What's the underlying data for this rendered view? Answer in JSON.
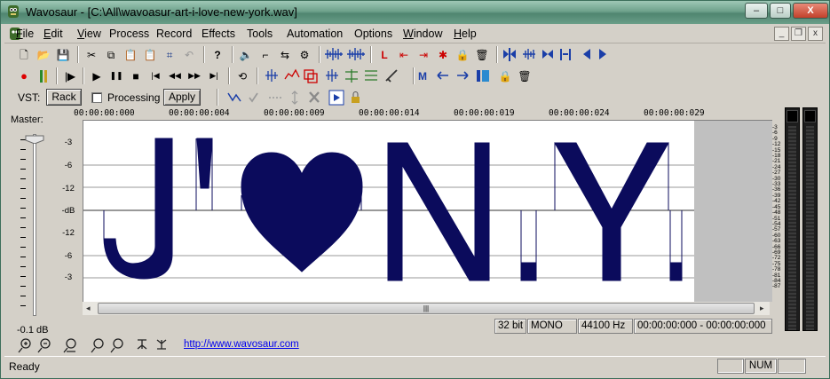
{
  "window": {
    "title": "Wavosaur - [C:\\All\\wavoasur-art-i-love-new-york.wav]",
    "buttons": {
      "minimize": "–",
      "maximize": "□",
      "close": "X"
    },
    "mdi_buttons": {
      "minimize": "_",
      "restore": "❐",
      "close": "x"
    }
  },
  "menu": [
    {
      "label": "File",
      "u": "F",
      "rest": "ile"
    },
    {
      "label": "Edit",
      "u": "E",
      "rest": "dit"
    },
    {
      "label": "View",
      "u": "V",
      "rest": "iew"
    },
    {
      "label": "Process",
      "u": "",
      "rest": "Process"
    },
    {
      "label": "Record",
      "u": "",
      "rest": "Record"
    },
    {
      "label": "Effects",
      "u": "",
      "rest": "Effects"
    },
    {
      "label": "Tools",
      "u": "",
      "rest": "Tools"
    },
    {
      "label": "Automation",
      "u": "",
      "rest": "Automation"
    },
    {
      "label": "Options",
      "u": "",
      "rest": "Options"
    },
    {
      "label": "Window",
      "u": "W",
      "rest": "indow"
    },
    {
      "label": "Help",
      "u": "H",
      "rest": "elp"
    }
  ],
  "icons": {
    "new": "🗋",
    "open": "📂",
    "save": "💾",
    "cut": "✂",
    "copy": "⧉",
    "paste": "📋",
    "undo": "↶",
    "help": "?",
    "record": "●",
    "play": "▶",
    "pause": "❚❚",
    "stop": "■",
    "rewind": "◀◀",
    "forward": "▶▶",
    "to_start": "|◀",
    "to_end": "▶|",
    "loop": "⟲",
    "lock": "🔒",
    "trash": "🗑",
    "cross": "✕",
    "check": "✔",
    "zoom_in": "🔍"
  },
  "vst": {
    "label": "VST:",
    "rack_button": "Rack",
    "processing_label": "Processing",
    "processing_checked": false,
    "apply_button": "Apply"
  },
  "master": {
    "label": "Master:",
    "value": "-0.1 dB"
  },
  "ruler": [
    "00:00:00:000",
    "00:00:00:004",
    "00:00:00:009",
    "00:00:00:014",
    "00:00:00:019",
    "00:00:00:024",
    "00:00:00:029"
  ],
  "db_scale": [
    "-3",
    "-6",
    "-12",
    "-dB",
    "-12",
    "-6",
    "-3"
  ],
  "meter_scale": [
    "-3",
    "-6",
    "-9",
    "-12",
    "-15",
    "-18",
    "-21",
    "-24",
    "-27",
    "-30",
    "-33",
    "-36",
    "-39",
    "-42",
    "-45",
    "-48",
    "-51",
    "-54",
    "-57",
    "-60",
    "-63",
    "-66",
    "-69",
    "-72",
    "-75",
    "-78",
    "-81",
    "-84",
    "-87"
  ],
  "info": {
    "bit_depth": "32 bit",
    "channels": "MONO",
    "sample_rate": "44100 Hz",
    "selection": "00:00:00:000 - 00:00:00:000"
  },
  "link": "http://www.wavosaur.com",
  "status": {
    "text": "Ready",
    "num": "NUM"
  },
  "colors": {
    "waveform": "#0b0b5c",
    "background": "#ffffff",
    "selection_gray": "#c0c0c0"
  }
}
